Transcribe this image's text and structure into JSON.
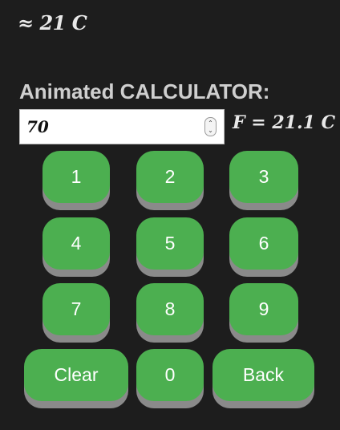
{
  "approx_reading": "≈ 21 C",
  "title": "Animated CALCULATOR:",
  "input": {
    "value": "70",
    "spinner_up": "⌃",
    "spinner_down": "⌄"
  },
  "result": "F = 21.1 C",
  "keypad": {
    "k1": "1",
    "k2": "2",
    "k3": "3",
    "k4": "4",
    "k5": "5",
    "k6": "6",
    "k7": "7",
    "k8": "8",
    "k9": "9",
    "clear": "Clear",
    "k0": "0",
    "back": "Back"
  },
  "colors": {
    "background": "#1d1d1d",
    "key": "#4caf50",
    "key_shadow": "#8a8a8a",
    "text": "#d9d9d9"
  }
}
